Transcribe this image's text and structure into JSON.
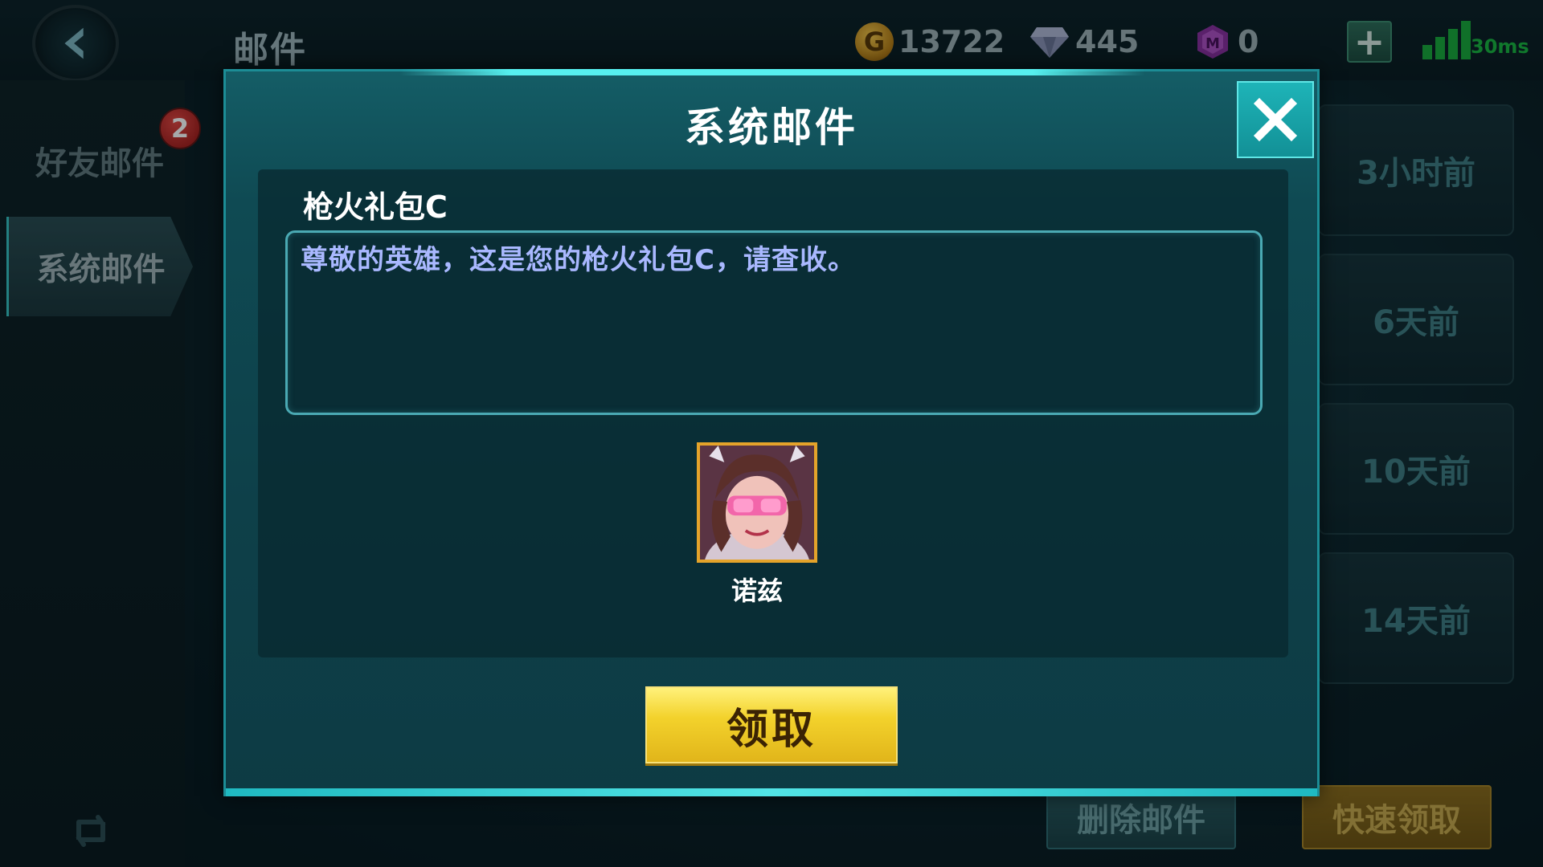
{
  "header": {
    "title": "邮件",
    "gold": "13722",
    "diamonds": "445",
    "gems": "0",
    "ping": "30ms",
    "coin_symbol": "G"
  },
  "sidebar": {
    "items": [
      {
        "label": "好友邮件",
        "badge": "2",
        "active": false
      },
      {
        "label": "系统邮件",
        "active": true
      }
    ]
  },
  "mail_list": {
    "times": [
      "3小时前",
      "6天前",
      "10天前",
      "14天前"
    ]
  },
  "footer": {
    "delete_label": "删除邮件",
    "quick_claim_label": "快速领取"
  },
  "modal": {
    "title": "系统邮件",
    "subject": "枪火礼包C",
    "body": "尊敬的英雄，这是您的枪火礼包C，请查收。",
    "reward": {
      "name": "诺兹",
      "icon": "hero-portrait"
    },
    "claim_label": "领取"
  },
  "colors": {
    "accent": "#1eb4b8",
    "claim_yellow": "#f3d22c",
    "body_text": "#a9b8ff",
    "badge_red": "#c72a27"
  }
}
